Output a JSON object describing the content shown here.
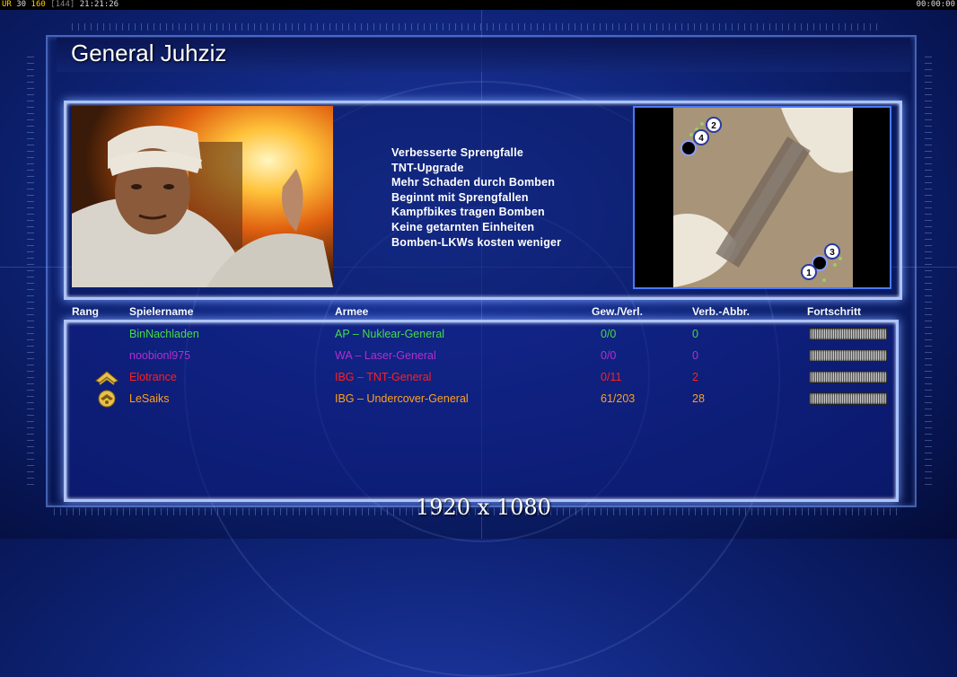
{
  "topbar": {
    "ur_label": "UR",
    "ur_value": "30",
    "fps": "160",
    "ping": "[144]",
    "clock": "21:21:26",
    "timer": "00:00:00"
  },
  "title": "General Juhziz",
  "features": [
    "Verbesserte Sprengfalle",
    "TNT-Upgrade",
    "Mehr Schaden durch Bomben",
    "Beginnt mit Sprengfallen",
    "Kampfbikes tragen Bomben",
    "Keine getarnten Einheiten",
    "Bomben-LKWs kosten weniger"
  ],
  "map": {
    "start_positions": [
      "1",
      "2",
      "3",
      "4"
    ]
  },
  "columns": {
    "rank": "Rang",
    "player": "Spielername",
    "army": "Armee",
    "winloss": "Gew./Verl.",
    "disconnects": "Verb.-Abbr.",
    "progress": "Fortschritt"
  },
  "players": [
    {
      "name": "BinNachladen",
      "army": "AP – Nuklear-General",
      "winloss": "0/0",
      "disconnects": "0",
      "color": "#44dd44",
      "rank_icon": "none"
    },
    {
      "name": "noobionl975",
      "army": "WA – Laser-General",
      "winloss": "0/0",
      "disconnects": "0",
      "color": "#b030d0",
      "rank_icon": "none"
    },
    {
      "name": "Elotrance",
      "army": "IBG – TNT-General",
      "winloss": "0/11",
      "disconnects": "2",
      "color": "#ff2020",
      "rank_icon": "chevron-rank-icon"
    },
    {
      "name": "LeSaiks",
      "army": "IBG – Undercover-General",
      "winloss": "61/203",
      "disconnects": "28",
      "color": "#ffa020",
      "rank_icon": "badge-rank-icon"
    }
  ],
  "resolution": "1920 x 1080"
}
